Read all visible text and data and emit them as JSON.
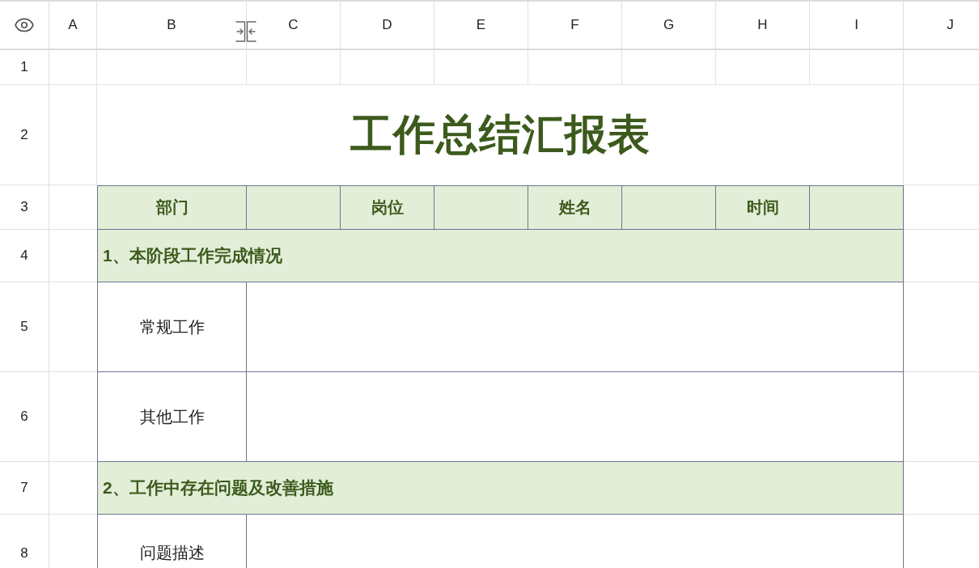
{
  "column_headers": [
    "A",
    "B",
    "C",
    "D",
    "E",
    "F",
    "G",
    "H",
    "I",
    "J"
  ],
  "row_headers": [
    "1",
    "2",
    "3",
    "4",
    "5",
    "6",
    "7",
    "8"
  ],
  "title": "工作总结汇报表",
  "info_fields": [
    {
      "label": "部门"
    },
    {
      "label": "岗位"
    },
    {
      "label": "姓名"
    },
    {
      "label": "时间"
    }
  ],
  "sections": [
    {
      "heading": "1、本阶段工作完成情况",
      "items": [
        {
          "label": "常规工作"
        },
        {
          "label": "其他工作"
        }
      ]
    },
    {
      "heading": "2、工作中存在问题及改善措施",
      "items": [
        {
          "label": "问题描述"
        }
      ]
    }
  ]
}
